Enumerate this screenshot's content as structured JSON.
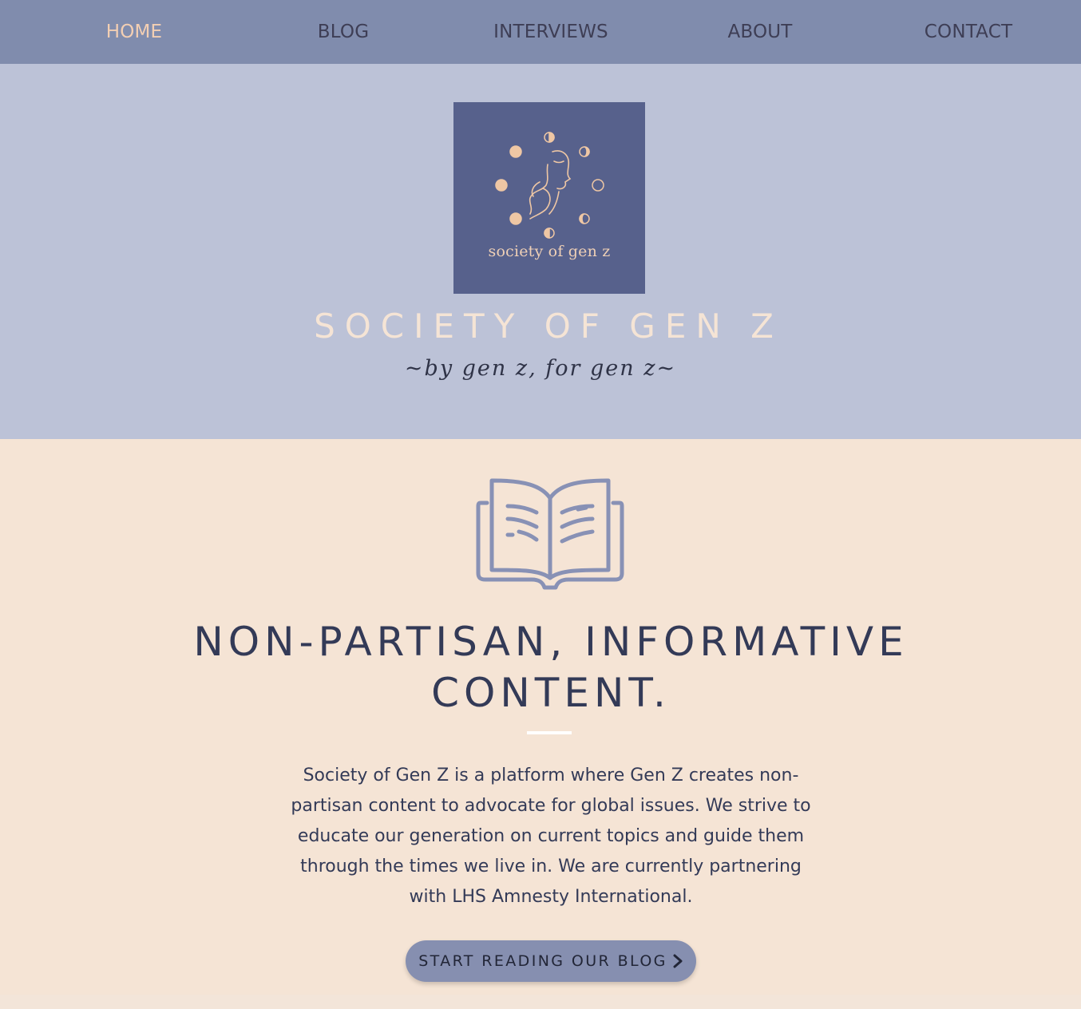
{
  "nav": {
    "items": [
      {
        "label": "HOME",
        "active": true
      },
      {
        "label": "BLOG",
        "active": false
      },
      {
        "label": "INTERVIEWS",
        "active": false
      },
      {
        "label": "ABOUT",
        "active": false
      },
      {
        "label": "CONTACT",
        "active": false
      }
    ]
  },
  "hero": {
    "logo_text": "society of gen z",
    "title": "SOCIETY OF GEN Z",
    "tagline": "~by gen z, for gen z~"
  },
  "content": {
    "headline": "NON-PARTISAN, INFORMATIVE CONTENT.",
    "description": "Society of Gen Z is a platform where Gen Z creates non-partisan content to advocate for global issues. We strive to educate our generation on current topics and guide them through the times we live in. We are currently partnering with LHS Amnesty International.",
    "cta_label": "START READING OUR BLOG"
  },
  "icons": {
    "logo": "moon-phases-face-logo",
    "book": "open-book-icon",
    "cta": "chevron-right-icon"
  },
  "colors": {
    "nav_bg": "#808cad",
    "nav_active": "#f3cfb3",
    "hero_bg": "#bcc2d7",
    "logo_bg": "#57618c",
    "content_bg": "#f5e4d5",
    "text_dark": "#333a57",
    "accent_peach": "#efd0b6",
    "book_stroke": "#8891b5"
  }
}
